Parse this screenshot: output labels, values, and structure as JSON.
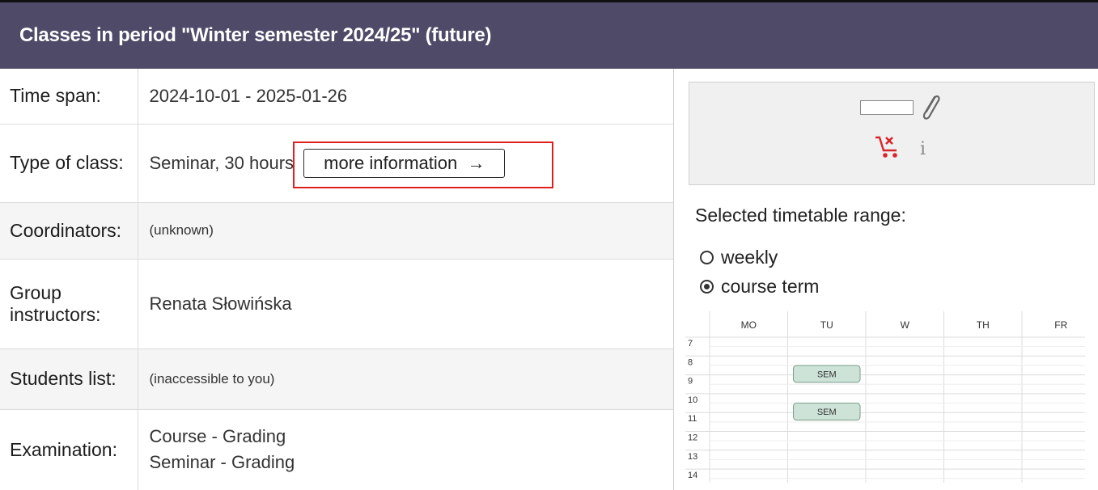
{
  "header": {
    "title": "Classes in period \"Winter semester 2024/25\" (future)"
  },
  "info": {
    "time_span_label": "Time span:",
    "time_span_value": "2024-10-01 - 2025-01-26",
    "type_label": "Type of class:",
    "type_value": "Seminar, 30 hours",
    "more_info_label": "more information",
    "more_info_arrow": "→",
    "coordinators_label": "Coordinators:",
    "coordinators_value": "(unknown)",
    "instructors_label_1": "Group",
    "instructors_label_2": "instructors:",
    "instructors_value": "Renata Słowińska",
    "students_label": "Students list:",
    "students_value": "(inaccessible to you)",
    "exam_label": "Examination:",
    "exam_value_1": "Course - Grading",
    "exam_value_2": "Seminar - Grading"
  },
  "panel": {
    "info_glyph": "i",
    "range_title": "Selected timetable range:",
    "radio_weekly": "weekly",
    "radio_course_term": "course term",
    "selected_range": "course term"
  },
  "timetable": {
    "days": [
      "MO",
      "TU",
      "W",
      "TH",
      "FR"
    ],
    "hours": [
      "7",
      "8",
      "9",
      "10",
      "11",
      "12",
      "13",
      "14"
    ],
    "events": [
      {
        "label": "SEM",
        "day": "TU",
        "start": 8.5,
        "end": 9.4
      },
      {
        "label": "SEM",
        "day": "TU",
        "start": 10.5,
        "end": 11.4
      }
    ]
  },
  "colors": {
    "header_bg": "#4e4a68",
    "highlight": "#e0201f",
    "cart": "#d9252b",
    "event_fill": "#cde3d7"
  }
}
